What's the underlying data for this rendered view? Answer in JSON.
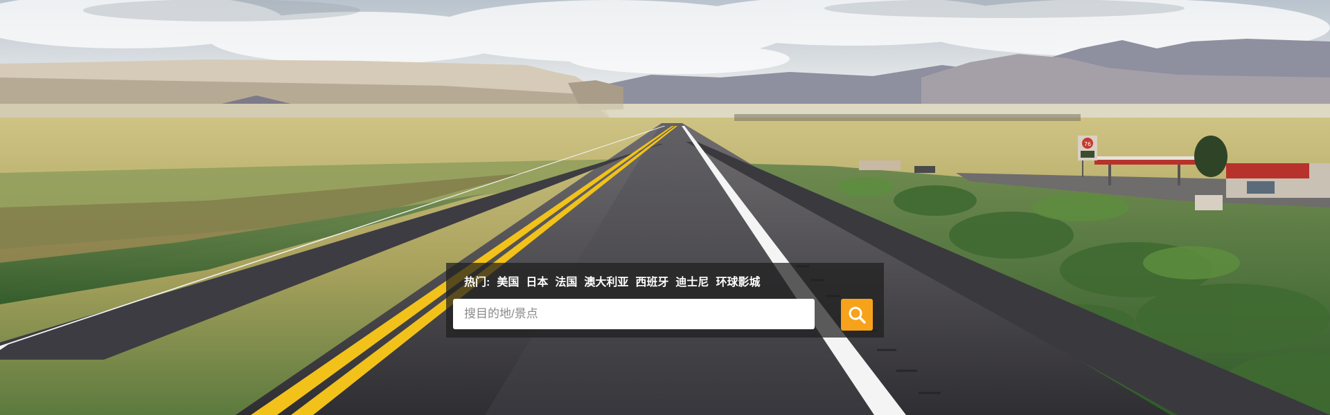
{
  "hero": {
    "image_alt": "open desert highway",
    "sign_text": "76"
  },
  "search": {
    "hot_label": "热门:",
    "hot_links": [
      "美国",
      "日本",
      "法国",
      "澳大利亚",
      "西班牙",
      "迪士尼",
      "环球影城"
    ],
    "placeholder": "搜目的地/景点",
    "value": ""
  },
  "icons": {
    "search_button": "magnifier-icon"
  },
  "colors": {
    "accent": "#f7a21b",
    "panel": "#1e1e1e"
  }
}
